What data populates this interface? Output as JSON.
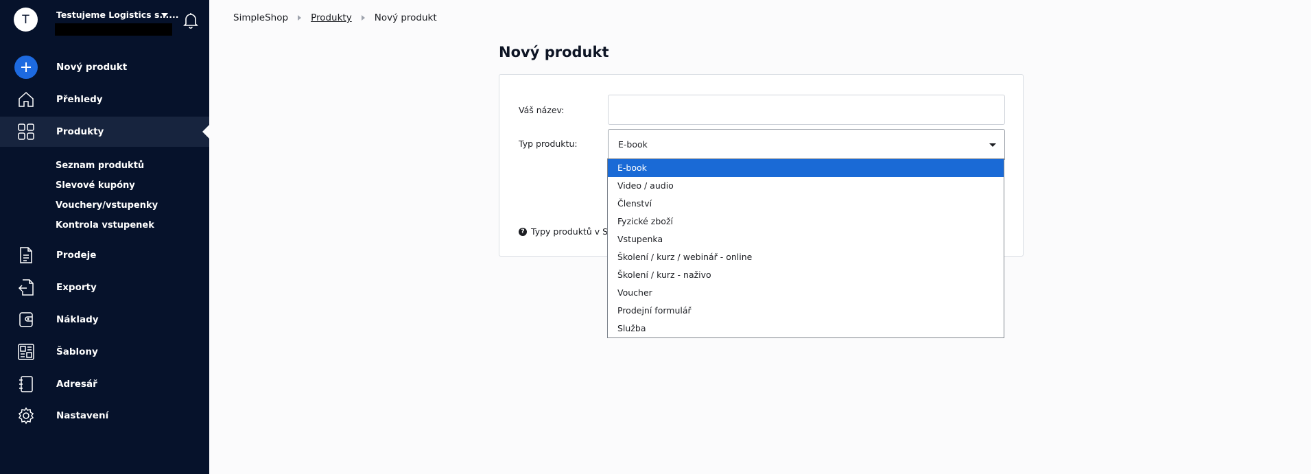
{
  "account": {
    "avatar_letter": "T",
    "name": "Testujeme Logistics s.r...."
  },
  "sidebar": {
    "new_product": "Nový produkt",
    "items": [
      {
        "label": "Přehledy",
        "icon": "home-icon"
      },
      {
        "label": "Produkty",
        "icon": "grid-icon"
      },
      {
        "label": "Prodeje",
        "icon": "document-icon"
      },
      {
        "label": "Exporty",
        "icon": "export-icon"
      },
      {
        "label": "Náklady",
        "icon": "wallet-icon"
      },
      {
        "label": "Šablony",
        "icon": "template-icon"
      },
      {
        "label": "Adresář",
        "icon": "address-book-icon"
      },
      {
        "label": "Nastavení",
        "icon": "gear-icon"
      }
    ],
    "sub_items": [
      "Seznam produktů",
      "Slevové kupóny",
      "Vouchery/vstupenky",
      "Kontrola vstupenek"
    ]
  },
  "breadcrumb": [
    "SimpleShop",
    "Produkty",
    "Nový produkt"
  ],
  "page_title": "Nový produkt",
  "form": {
    "name_label": "Váš název:",
    "name_value": "",
    "type_label": "Typ produktu:",
    "type_value": "E-book",
    "help_text": "Typy produktů v Sir"
  },
  "dropdown_options": [
    "E-book",
    "Video / audio",
    "Členství",
    "Fyzické zboží",
    "Vstupenka",
    "Školení / kurz / webinář - online",
    "Školení / kurz - naživo",
    "Voucher",
    "Prodejní formulář",
    "Služba"
  ],
  "colors": {
    "sidebar_bg": "#06122b",
    "active_bg": "#17243e",
    "accent": "#1d6ae0",
    "selected_option": "#1a6ad6"
  }
}
